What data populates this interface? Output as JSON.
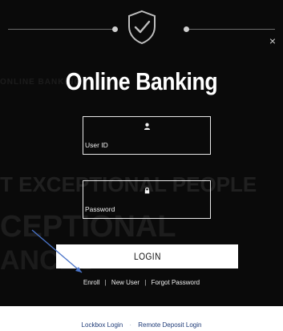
{
  "modal": {
    "background_words": [
      "Online Banking",
      "T EXCEPTIONAL PEOPLE",
      "CEPTIONAL",
      "ANCES"
    ],
    "title": "Online Banking",
    "close_glyph": "×",
    "shield_icon": "shield-check-icon"
  },
  "form": {
    "user_id_label": "User ID",
    "user_icon": "user-icon",
    "password_label": "Password",
    "password_icon": "lock-icon",
    "login_label": "LOGIN"
  },
  "links": {
    "enroll": "Enroll",
    "separator": "|",
    "new_user": "New User",
    "forgot_password": "Forgot Password"
  },
  "footer": {
    "lockbox_login": "Lockbox Login",
    "separator": "·",
    "remote_deposit_login": "Remote Deposit Login"
  },
  "colors": {
    "modal_bg": "#0a0a0a",
    "footer_link": "#1d3a77",
    "annotation_arrow": "#4a74c9"
  }
}
